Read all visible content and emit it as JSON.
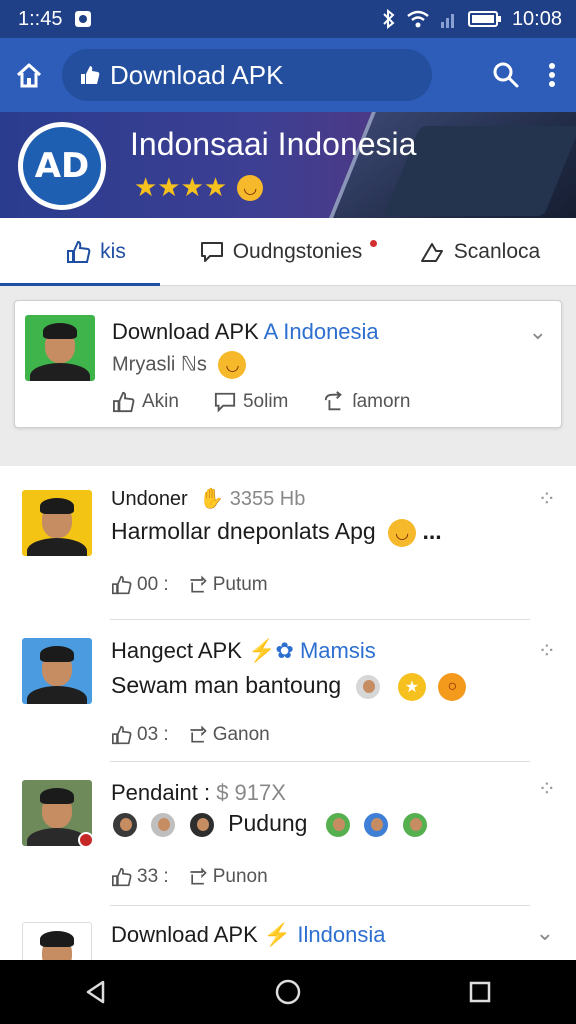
{
  "status_bar": {
    "time_left": "1::45",
    "time_right": "10:08"
  },
  "app_bar": {
    "url_text": "Download APK"
  },
  "banner": {
    "title": "Indonsaai Indonesia",
    "stars": "★★★★",
    "logo_text": "AD"
  },
  "tabs": [
    {
      "label": "kis"
    },
    {
      "label": "Oudngstonies"
    },
    {
      "label": "Scanloca"
    }
  ],
  "featured": {
    "title": "Download APK",
    "title_accent": "A Indonesia",
    "subtitle": "Mryasli ℕs",
    "actions": {
      "like": "Akin",
      "comment": "5olim",
      "share": "ſamorn"
    }
  },
  "posts": [
    {
      "author": "Undoner",
      "meta": "3355 Hb",
      "text": "Harmollar dneponlats Apg",
      "trailing": "...",
      "likes": "00 :",
      "action": "Putum",
      "avatar_bg": "#f4c414"
    },
    {
      "author": "Hangect APK",
      "accent": "Mamsis",
      "text": "Sewam man bantoung",
      "likes": "03 :",
      "action": "Ganon",
      "avatar_bg": "#4a9be0"
    },
    {
      "author": "Pendaint :",
      "meta": "$ 917X",
      "text": "Pudung",
      "likes": "33 :",
      "action": "Punon",
      "avatar_bg": "#6f8a5a"
    },
    {
      "author": "Download APK",
      "accent": "Ilndonsia",
      "avatar_bg": "#ffffff"
    }
  ],
  "colors": {
    "app_bar": "#2d5db8",
    "status_bar": "#1f3f86",
    "accent": "#2d6fd0"
  }
}
